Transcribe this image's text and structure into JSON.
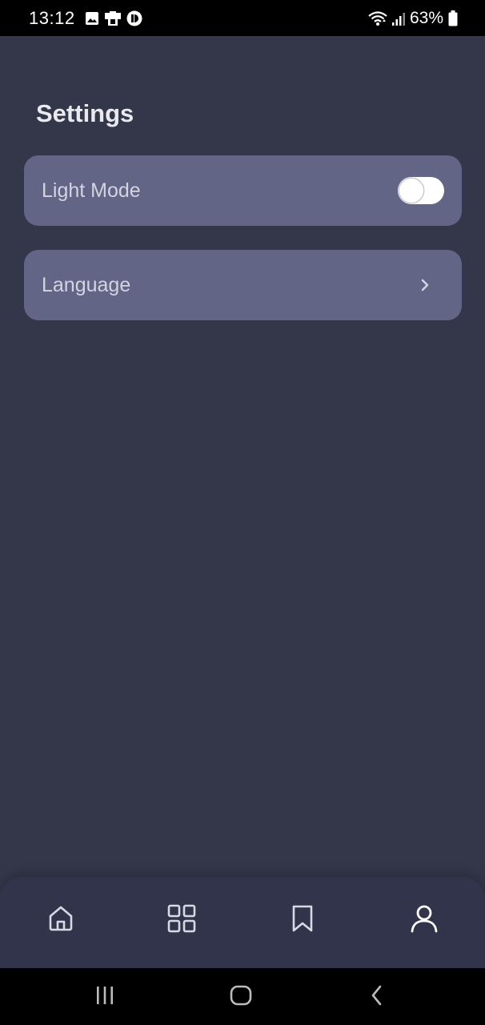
{
  "status_bar": {
    "time": "13:12",
    "battery": "63%",
    "icons": [
      "gallery-icon",
      "notification-app-icon",
      "app-icon",
      "wifi-icon",
      "signal-icon",
      "battery-icon"
    ]
  },
  "page": {
    "title": "Settings"
  },
  "settings": {
    "light_mode": {
      "label": "Light Mode",
      "enabled": false
    },
    "language": {
      "label": "Language"
    }
  },
  "bottom_nav": {
    "items": [
      {
        "icon": "home-icon"
      },
      {
        "icon": "grid-icon"
      },
      {
        "icon": "bookmark-icon"
      },
      {
        "icon": "profile-icon"
      }
    ]
  },
  "system_nav": {
    "items": [
      {
        "icon": "recents-icon"
      },
      {
        "icon": "home-circle-icon"
      },
      {
        "icon": "back-icon"
      }
    ]
  },
  "colors": {
    "background": "#343649",
    "card": "#626586",
    "nav_bar": "#31344a",
    "text": "#e6e7ee",
    "label": "#d3d4e0"
  }
}
